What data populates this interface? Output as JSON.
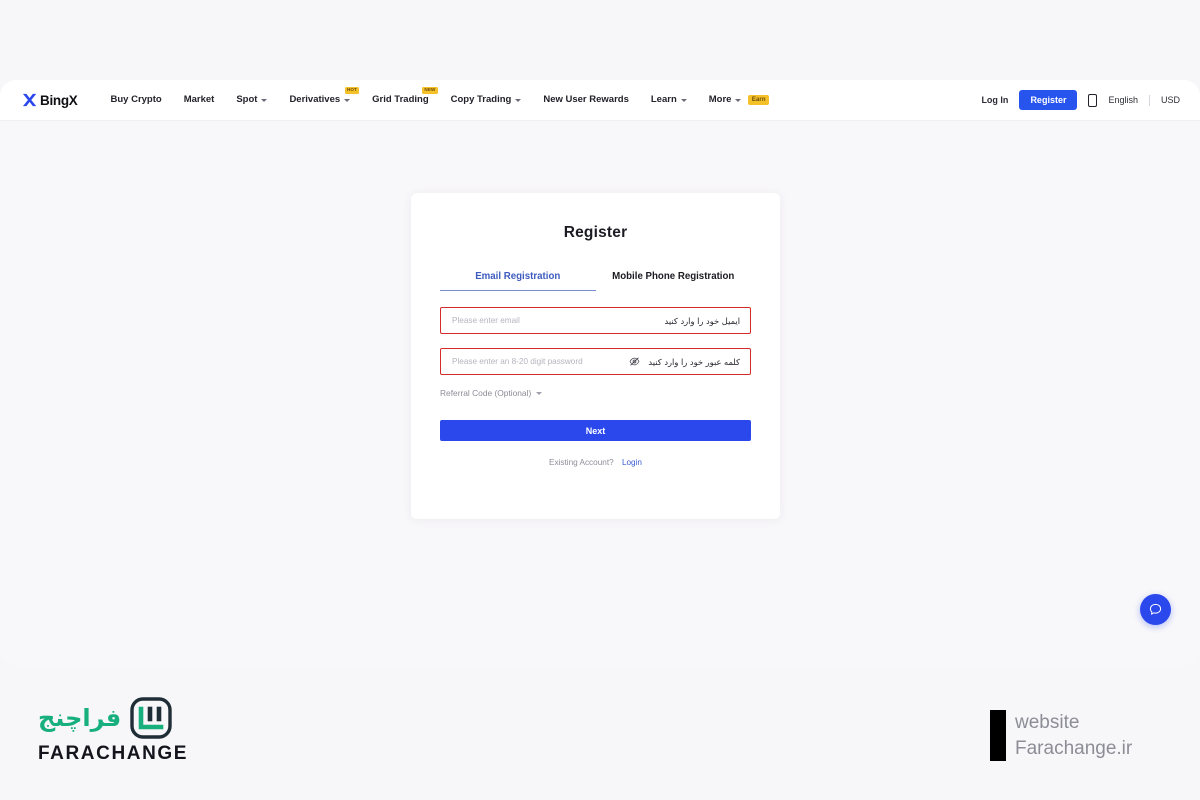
{
  "browser": {
    "background_color": "#f7f6f9",
    "canvas_color": "#f8f7fa"
  },
  "navbar": {
    "brand": {
      "name": "BingX",
      "mark_color": "#2b48ed",
      "text_color": "#101013"
    },
    "items": [
      {
        "label": "Buy Crypto",
        "caret": false,
        "badge": ""
      },
      {
        "label": "Market",
        "caret": false,
        "badge": ""
      },
      {
        "label": "Spot",
        "caret": true,
        "badge": ""
      },
      {
        "label": "Derivatives",
        "caret": true,
        "badge": "HOT"
      },
      {
        "label": "Grid Trading",
        "caret": false,
        "badge": "NEW"
      },
      {
        "label": "Copy Trading",
        "caret": true,
        "badge": ""
      },
      {
        "label": "New User Rewards",
        "caret": false,
        "badge": ""
      },
      {
        "label": "Learn",
        "caret": true,
        "badge": ""
      },
      {
        "label": "More",
        "caret": true,
        "badge": "Earn"
      }
    ],
    "badge_bg": "#f5c12a",
    "badge_text_color": "#6a4a05",
    "right": {
      "login_label": "Log In",
      "register_label": "Register",
      "register_bg": "#2654ec",
      "mobile_icon": "mobile-phone-icon",
      "language": "English",
      "currency": "USD"
    }
  },
  "card": {
    "title": "Register",
    "tabs": [
      {
        "label": "Email Registration",
        "active": true
      },
      {
        "label": "Mobile Phone Registration",
        "active": false
      }
    ],
    "active_tab_color": "#3d5bbf",
    "fields": [
      {
        "name": "email",
        "placeholder": "Please enter email",
        "value": "",
        "annotation_fa": "ایمیل خود را وارد کنید",
        "annotation_border": "#d32a2a",
        "has_eye_icon": false
      },
      {
        "name": "password",
        "placeholder": "Please enter an 8-20 digit password",
        "value": "",
        "annotation_fa": "کلمه عبور خود را وارد کنید",
        "annotation_border": "#d32a2a",
        "has_eye_icon": true
      }
    ],
    "referral_label": "Referral Code (Optional)",
    "next_label": "Next",
    "next_bg": "#2b48ed",
    "existing_label": "Existing Account?",
    "login_label": "Login"
  },
  "chat": {
    "icon": "chat-bubble-icon",
    "color": "#2b48ed"
  },
  "footer": {
    "logo_fa": "فراچنج",
    "logo_en": "FARACHANGE",
    "logo_green": "#17b07d",
    "site_line_1": "website",
    "site_line_2": "Farachange.ir"
  }
}
